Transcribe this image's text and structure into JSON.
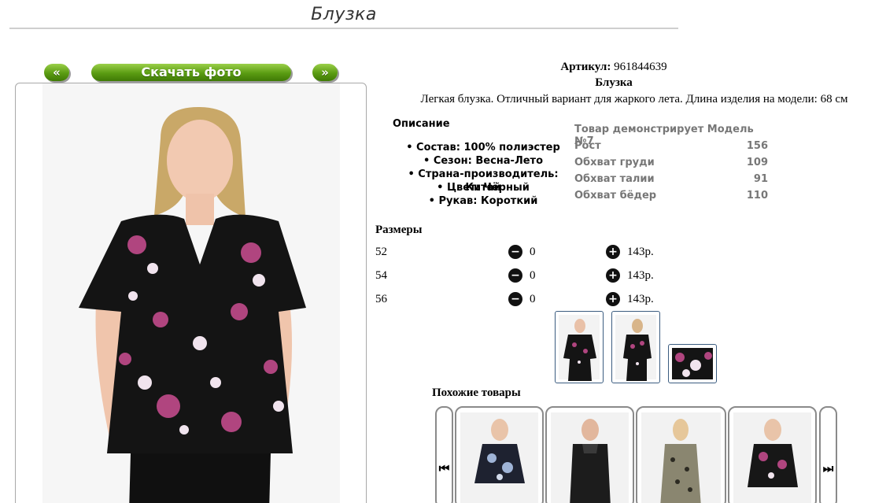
{
  "page": {
    "title": "Блузка"
  },
  "photo_nav": {
    "prev_label": "«",
    "download_label": "Скачать фото",
    "next_label": "»"
  },
  "product": {
    "article_label": "Артикул:",
    "article_value": "961844639",
    "name": "Блузка",
    "description": "Легкая блузка. Отличный вариант для жаркого лета. Длина изделия на модели: 68 см"
  },
  "specs": {
    "heading": "Описание",
    "items": [
      "Состав: 100% полиэстер",
      "Сезон: Весна-Лето",
      "Страна-производитель: Китай",
      "Цвет: Чёрный",
      "Рукав: Короткий"
    ]
  },
  "model": {
    "heading": "Товар демонстрирует Модель №7",
    "rows": [
      {
        "label": "Рост",
        "value": "156"
      },
      {
        "label": "Обхват груди",
        "value": "109"
      },
      {
        "label": "Обхват талии",
        "value": "91"
      },
      {
        "label": "Обхват бёдер",
        "value": "110"
      }
    ]
  },
  "sizes": {
    "title": "Размеры",
    "rows": [
      {
        "size": "52",
        "qty": "0",
        "price": "143р."
      },
      {
        "size": "54",
        "qty": "0",
        "price": "143р."
      },
      {
        "size": "56",
        "qty": "0",
        "price": "143р."
      }
    ]
  },
  "similar": {
    "title": "Похожие товары",
    "prev_arrow": "⏮",
    "next_arrow": "⏭"
  },
  "colors": {
    "button_green": "#5a9b12",
    "blouse_black": "#141414",
    "flower_pink": "#b0457f",
    "flower_white": "#f1e4ee"
  }
}
